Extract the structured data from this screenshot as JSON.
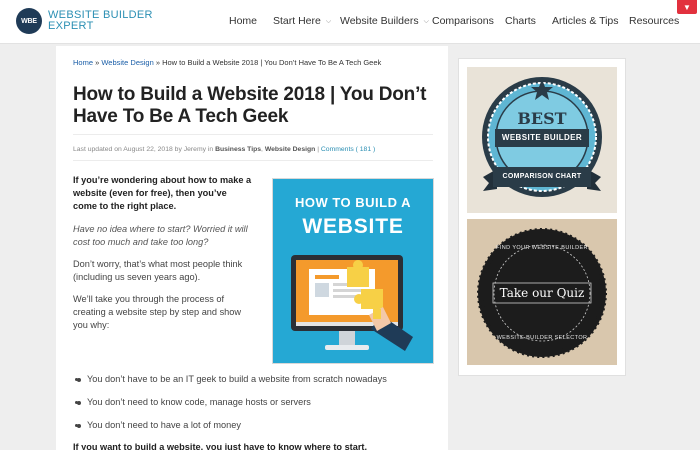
{
  "header": {
    "logo_mark": "WBE",
    "logo_line1": "WEBSITE BUILDER",
    "logo_line2": "EXPERT",
    "nav": [
      "Home",
      "Start Here",
      "Website Builders",
      "Comparisons",
      "Charts",
      "Articles & Tips",
      "Resources"
    ],
    "nav_has_caret": [
      false,
      true,
      true,
      false,
      false,
      false,
      true
    ],
    "menu_icon": "chevron-down-icon",
    "accent_color": "#e2313e"
  },
  "breadcrumb": {
    "home": "Home",
    "sep1": " » ",
    "section": "Website Design",
    "sep2": " » ",
    "current": "How to Build a Website 2018 | You Don’t Have To Be A Tech Geek"
  },
  "article": {
    "title": "How to Build a Website 2018 | You Don’t Have To Be A Tech Geek",
    "meta_updated": "Last updated on August 22, 2018  by Jeremy in ",
    "meta_cat1": "Business Tips",
    "meta_sep": ", ",
    "meta_cat2": "Website Design",
    "meta_bar": " | ",
    "meta_comments": "Comments ( 181 )",
    "intro_bold": "If you’re wondering about how to make a website (even for free), then you’ve come to the right place.",
    "intro_italic": "Have no idea where to start? Worried it will cost too much and take too long?",
    "para1": "Don’t worry, that’s what most people think (including us seven years ago).",
    "para2": "We’ll take you through the process of creating a website step by step and show you why:",
    "bullets": [
      "You don’t have to be an IT geek to build a website from scratch nowadays",
      "You don’t need to know code, manage hosts or servers",
      "You don’t need to have a lot of money"
    ],
    "cutoff": "If you want to build a website, you just have to know where to start."
  },
  "hero_image": {
    "line1": "HOW TO BUILD A",
    "line2": "WEBSITE",
    "bg_color": "#25a8d4"
  },
  "sidebar": {
    "badge": {
      "top": "BEST",
      "middle": "WEBSITE BUILDER",
      "ribbon": "COMPARISON CHART"
    },
    "quiz": {
      "arc_top": "FIND YOUR WEBSITE BUILDER",
      "center": "Take our Quiz",
      "arc_bottom": "WEBSITE BUILDER SELECTOR"
    }
  }
}
